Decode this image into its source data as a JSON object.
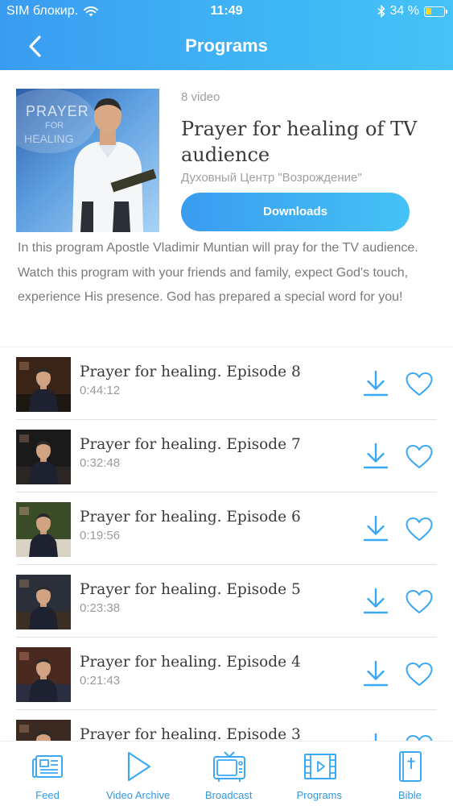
{
  "status_bar": {
    "carrier": "SIM блокир.",
    "time": "11:49",
    "battery_percent": "34 %",
    "battery_level": 0.34,
    "wifi_icon": "wifi-icon",
    "bluetooth_icon": "bluetooth-icon"
  },
  "header": {
    "title": "Programs",
    "back_icon": "chevron-left-icon"
  },
  "program": {
    "cover_text": "PRAYER",
    "cover_text2": "FOR",
    "cover_text3": "HEALING",
    "video_count": "8 video",
    "title": "Prayer for healing of TV audience",
    "subtitle": "Духовный Центр \"Возрождение\"",
    "downloads_label": "Downloads",
    "description": "In this program Apostle Vladimir Muntian will pray for the TV audience. Watch this program with your friends and family, expect God's touch, experience His presence. God has prepared a special word for you!"
  },
  "episodes": [
    {
      "title": "Prayer for healing. Episode 8",
      "duration": "0:44:12"
    },
    {
      "title": "Prayer for healing. Episode 7",
      "duration": "0:32:48"
    },
    {
      "title": "Prayer for healing. Episode 6",
      "duration": "0:19:56"
    },
    {
      "title": "Prayer for healing. Episode 5",
      "duration": "0:23:38"
    },
    {
      "title": "Prayer for healing. Episode 4",
      "duration": "0:21:43"
    },
    {
      "title": "Prayer for healing. Episode 3",
      "duration": ""
    }
  ],
  "tabs": [
    {
      "label": "Feed",
      "icon": "newspaper-icon"
    },
    {
      "label": "Video Archive",
      "icon": "play-icon"
    },
    {
      "label": "Broadcast",
      "icon": "tv-icon"
    },
    {
      "label": "Programs",
      "icon": "film-icon"
    },
    {
      "label": "Bible",
      "icon": "bible-icon"
    }
  ],
  "colors": {
    "accent": "#3aa8f2",
    "accent_dark": "#2f9ae6",
    "text_dark": "#3a3a3a",
    "text_muted": "#9a9a9a"
  }
}
